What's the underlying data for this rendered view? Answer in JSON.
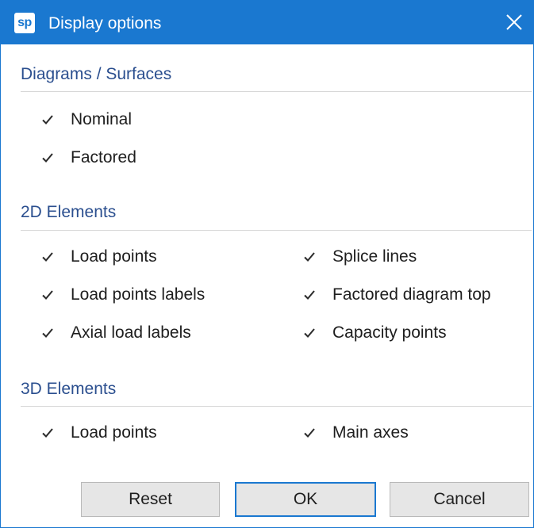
{
  "window": {
    "logo_text": "sp",
    "title": "Display options",
    "close_icon": "close-icon",
    "accent_color": "#1a78d0"
  },
  "sections": {
    "diagrams": {
      "title": "Diagrams / Surfaces",
      "items": [
        {
          "label": "Nominal",
          "checked": true
        },
        {
          "label": "Factored",
          "checked": true
        }
      ]
    },
    "elements_2d": {
      "title": "2D Elements",
      "items": [
        {
          "label": "Load points",
          "checked": true
        },
        {
          "label": "Load points labels",
          "checked": true
        },
        {
          "label": "Axial load labels",
          "checked": true
        },
        {
          "label": "Splice lines",
          "checked": true
        },
        {
          "label": "Factored diagram top",
          "checked": true
        },
        {
          "label": "Capacity points",
          "checked": true
        }
      ]
    },
    "elements_3d": {
      "title": "3D Elements",
      "items": [
        {
          "label": "Load points",
          "checked": true
        },
        {
          "label": "Main axes",
          "checked": true
        }
      ]
    }
  },
  "buttons": {
    "reset": "Reset",
    "ok": "OK",
    "cancel": "Cancel"
  }
}
